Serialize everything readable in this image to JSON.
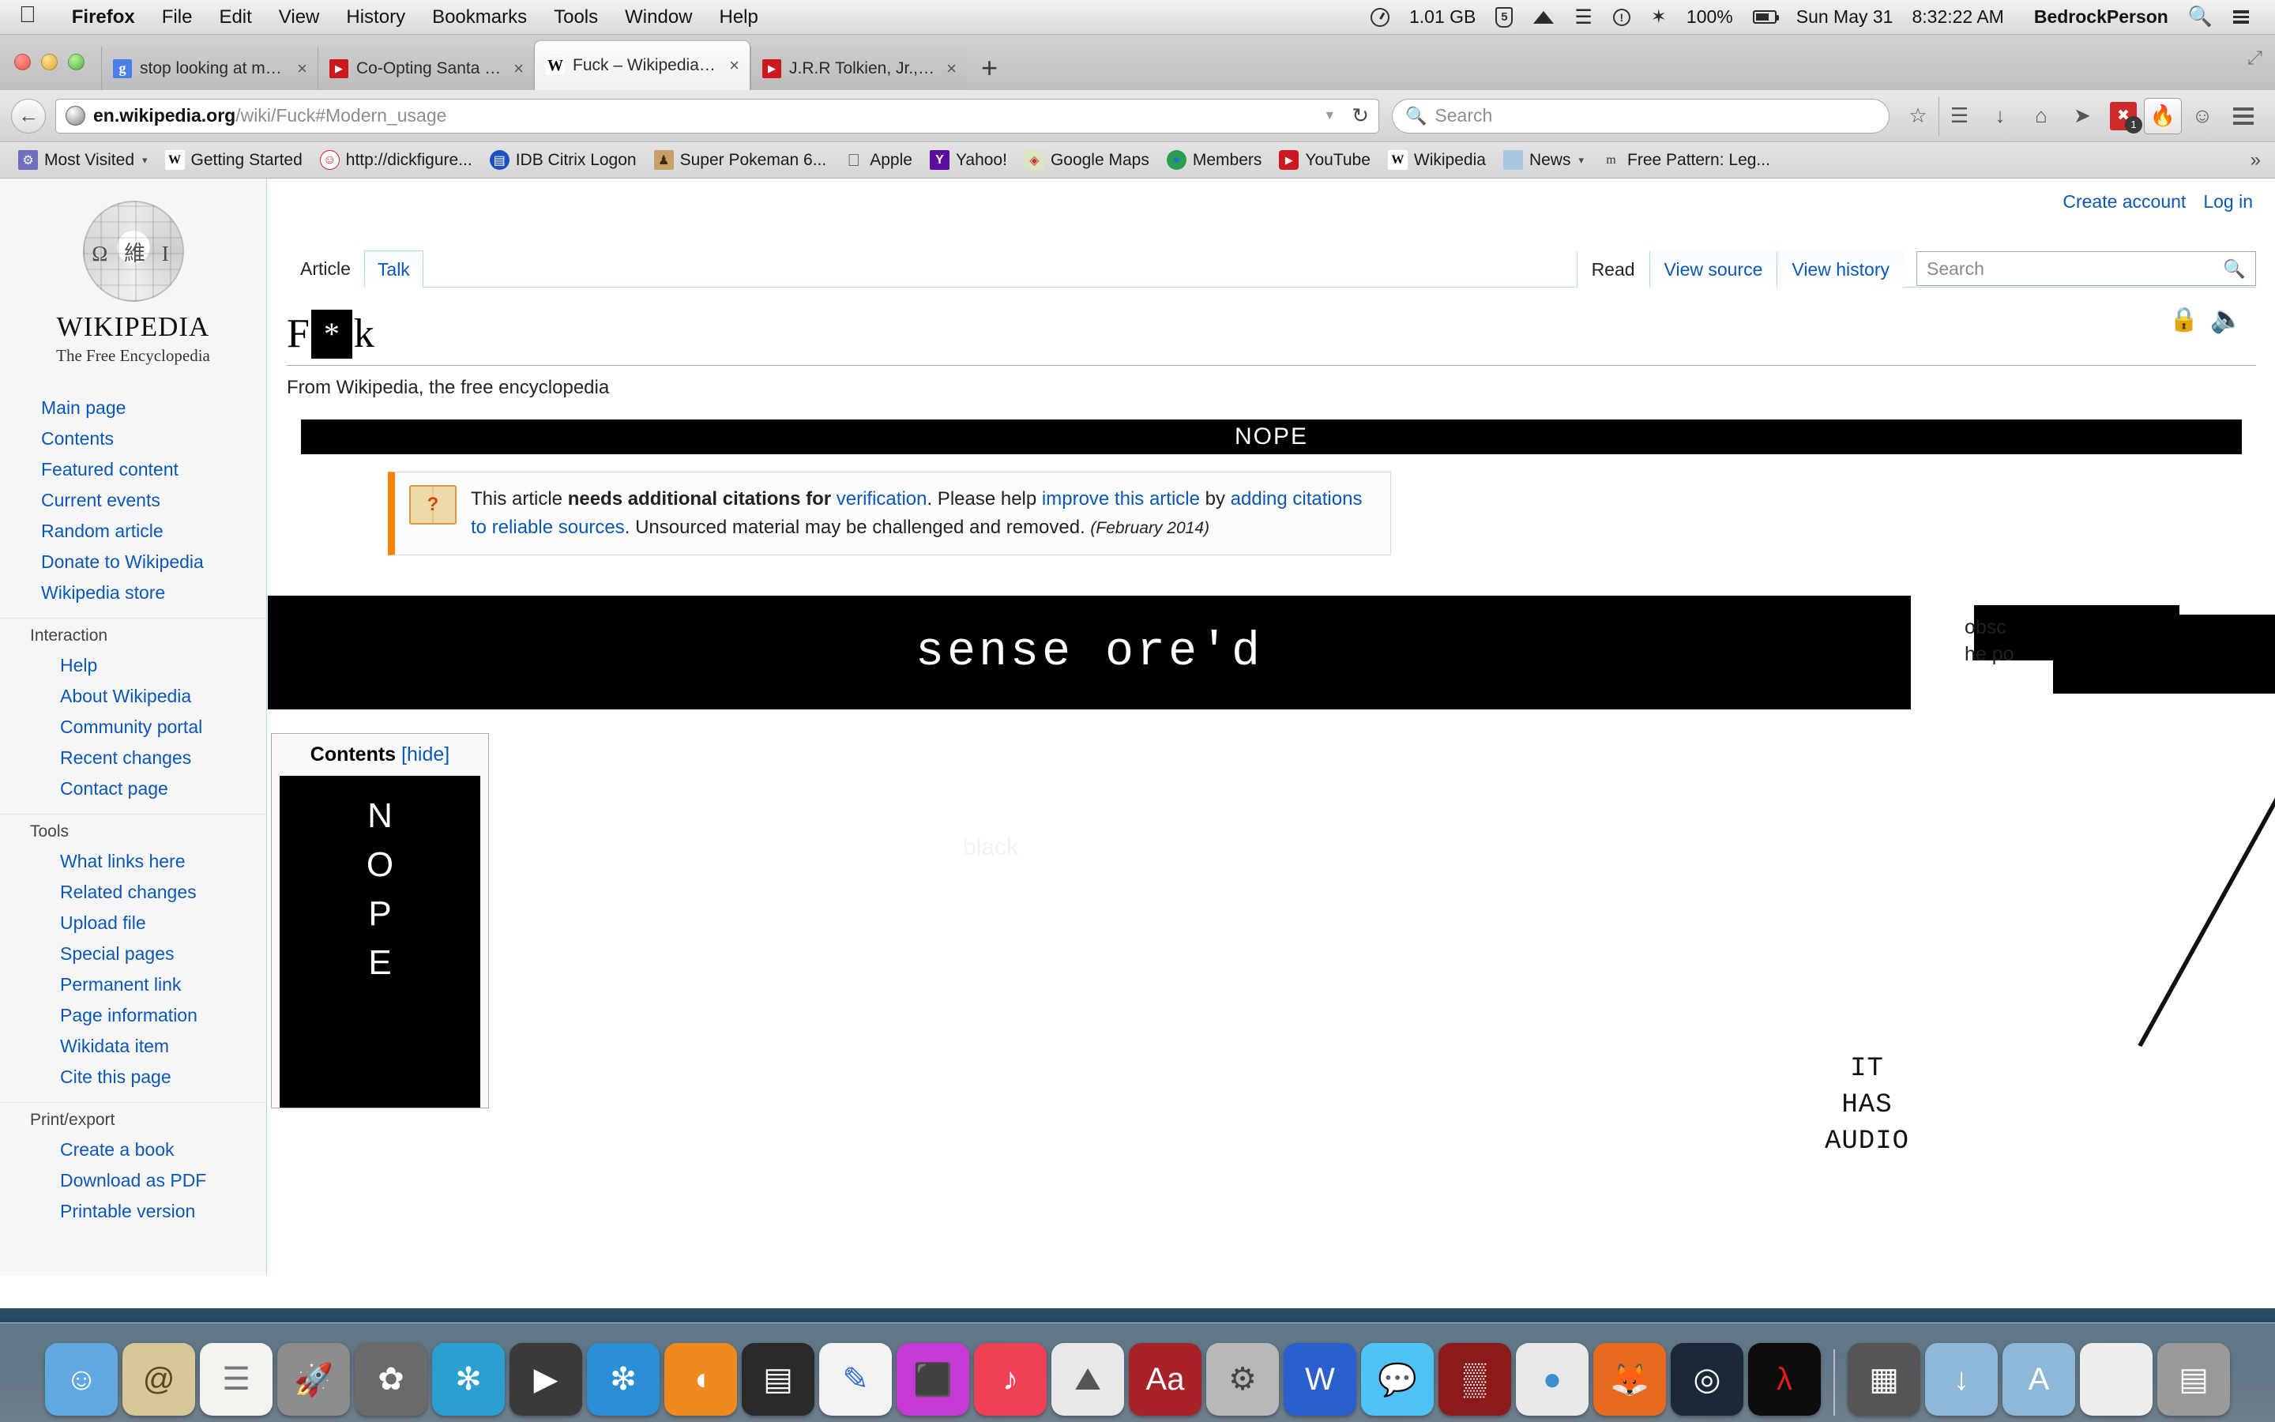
{
  "menubar": {
    "apple": "",
    "items": [
      {
        "label": "Firefox",
        "bold": true
      },
      {
        "label": "File"
      },
      {
        "label": "Edit"
      },
      {
        "label": "View"
      },
      {
        "label": "History"
      },
      {
        "label": "Bookmarks"
      },
      {
        "label": "Tools"
      },
      {
        "label": "Window"
      },
      {
        "label": "Help"
      }
    ],
    "status": {
      "memory": "1.01 GB",
      "badge": "5",
      "notify_glyph": "!",
      "bluetooth_glyph": "✶",
      "battery_percent": "100%",
      "date": "Sun May 31",
      "time": "8:32:22 AM",
      "user": "BedrockPerson",
      "search_icon": "search-icon",
      "list_icon": "notification-center-icon"
    }
  },
  "browser": {
    "tabs": [
      {
        "title": "stop looking at my tabs – ...",
        "favicon": "google-icon",
        "favicon_glyph": "g",
        "active": false
      },
      {
        "title": "Co-Opting Santa | Rob...",
        "favicon": "youtube-icon",
        "favicon_glyph": "▶",
        "active": false
      },
      {
        "title": "Fuck – Wikipedia, the free...",
        "favicon": "wikipedia-icon",
        "favicon_glyph": "W",
        "active": true
      },
      {
        "title": "J.R.R Tolkien, Jr., Jr. | Rob...",
        "favicon": "youtube-icon",
        "favicon_glyph": "▶",
        "active": false
      }
    ],
    "new_tab_label": "+",
    "close_glyph": "×",
    "nav": {
      "back_glyph": "←",
      "url_host": "en.wikipedia.org",
      "url_path": "/wiki/Fuck#Modern_usage",
      "dropdown_glyph": "▼",
      "reload_glyph": "↻",
      "search_placeholder": "Search",
      "search_icon": "search-icon",
      "icons": [
        {
          "name": "bookmark-star-icon",
          "glyph": "☆"
        },
        {
          "name": "reading-list-icon",
          "glyph": "☰"
        },
        {
          "name": "downloads-icon",
          "glyph": "↓"
        },
        {
          "name": "home-icon",
          "glyph": "⌂"
        },
        {
          "name": "send-tab-icon",
          "glyph": "➤"
        },
        {
          "name": "adblock-icon",
          "glyph": "✖",
          "badge": "1"
        },
        {
          "name": "fire-extension-icon",
          "glyph": "🔥"
        },
        {
          "name": "chat-extension-icon",
          "glyph": "☺"
        },
        {
          "name": "menu-hamburger-icon",
          "glyph": "☰"
        }
      ]
    },
    "bookmarks": [
      {
        "label": "Most Visited",
        "icon": "folder-icon",
        "glyph": "⚙",
        "caret": "▾",
        "color": "#6f6fbe"
      },
      {
        "label": "Getting Started",
        "icon": "wikipedia-icon",
        "glyph": "W",
        "color": "#ffffff",
        "text_color": "#000"
      },
      {
        "label": "http://dickfigure...",
        "icon": "dickfigures-icon",
        "glyph": "☺",
        "color": "#ffffff",
        "text_color": "#d22"
      },
      {
        "label": "IDB Citrix Logon",
        "icon": "citrix-icon",
        "glyph": "▤",
        "color": "#1f4fc4"
      },
      {
        "label": "Super Pokeman 6...",
        "icon": "sprite-icon",
        "glyph": "♟",
        "color": "#c9a06a"
      },
      {
        "label": "Apple",
        "icon": "apple-icon",
        "glyph": "",
        "color": "transparent",
        "text_color": "#555"
      },
      {
        "label": "Yahoo!",
        "icon": "yahoo-icon",
        "glyph": "Y",
        "color": "#5b0d9e"
      },
      {
        "label": "Google Maps",
        "icon": "maps-icon",
        "glyph": "◈",
        "color": "#d9e6c3",
        "text_color": "#c33"
      },
      {
        "label": "Members",
        "icon": "globe-icon",
        "glyph": "●",
        "color": "#2a9d4f"
      },
      {
        "label": "YouTube",
        "icon": "youtube-icon",
        "glyph": "▶",
        "color": "#cc181e"
      },
      {
        "label": "Wikipedia",
        "icon": "wikipedia-icon",
        "glyph": "W",
        "color": "#ffffff",
        "text_color": "#000"
      },
      {
        "label": "News",
        "icon": "folder-icon",
        "glyph": "",
        "caret": "▾",
        "color": "#a8c8e0"
      },
      {
        "label": "Free Pattern: Leg...",
        "icon": "ravelry-icon",
        "glyph": "m",
        "color": "transparent",
        "text_color": "#333"
      }
    ],
    "bookmarks_overflow_glyph": "»"
  },
  "wikipedia": {
    "wordmark": "WIKIPEDIA",
    "tagline": "The Free Encyclopedia",
    "logo_chars": "Ω 維 I",
    "user_nav": [
      "Create account",
      "Log in"
    ],
    "namespace_tabs": [
      {
        "label": "Article",
        "selected": true
      },
      {
        "label": "Talk",
        "selected": false
      }
    ],
    "view_tabs": [
      {
        "label": "Read",
        "selected": true
      },
      {
        "label": "View source",
        "selected": false
      },
      {
        "label": "View history",
        "selected": false
      }
    ],
    "search_placeholder": "Search",
    "search_icon": "search-icon",
    "sidebar": [
      {
        "type": "link",
        "label": "Main page"
      },
      {
        "type": "link",
        "label": "Contents"
      },
      {
        "type": "link",
        "label": "Featured content"
      },
      {
        "type": "link",
        "label": "Current events"
      },
      {
        "type": "link",
        "label": "Random article"
      },
      {
        "type": "link",
        "label": "Donate to Wikipedia"
      },
      {
        "type": "link",
        "label": "Wikipedia store"
      },
      {
        "type": "head",
        "label": "Interaction"
      },
      {
        "type": "sublink",
        "label": "Help"
      },
      {
        "type": "sublink",
        "label": "About Wikipedia"
      },
      {
        "type": "sublink",
        "label": "Community portal"
      },
      {
        "type": "sublink",
        "label": "Recent changes"
      },
      {
        "type": "sublink",
        "label": "Contact page"
      },
      {
        "type": "head",
        "label": "Tools"
      },
      {
        "type": "sublink",
        "label": "What links here"
      },
      {
        "type": "sublink",
        "label": "Related changes"
      },
      {
        "type": "sublink",
        "label": "Upload file"
      },
      {
        "type": "sublink",
        "label": "Special pages"
      },
      {
        "type": "sublink",
        "label": "Permanent link"
      },
      {
        "type": "sublink",
        "label": "Page information"
      },
      {
        "type": "sublink",
        "label": "Wikidata item"
      },
      {
        "type": "sublink",
        "label": "Cite this page"
      },
      {
        "type": "head",
        "label": "Print/export"
      },
      {
        "type": "sublink",
        "label": "Create a book"
      },
      {
        "type": "sublink",
        "label": "Download as PDF"
      },
      {
        "type": "sublink",
        "label": "Printable version"
      }
    ],
    "article": {
      "title_prefix": "F",
      "title_redacted": "*",
      "title_suffix": "k",
      "subtitle": "From Wikipedia, the free encyclopedia",
      "lock_icon": "semi-protected-lock-icon",
      "audio_icon": "spoken-article-audio-icon",
      "nope_banner": "NOPE",
      "citation_notice": {
        "text_1": "This article ",
        "bold_1": "needs additional citations for ",
        "link_1": "verification",
        "text_2": ". Please help ",
        "link_2": "improve this article",
        "text_3": " by ",
        "link_3": "adding citations to reliable sources",
        "text_4": ". Unsourced material may be challenged and removed.",
        "date": "(February 2014)",
        "icon": "open-book-question-icon"
      },
      "big_redaction_text": "sense ore'd",
      "leaked_fragment_1": "obsc",
      "leaked_fragment_2": "he po",
      "ghost_text": "black"
    },
    "toc": {
      "heading": "Contents",
      "toggle": "[hide]",
      "redacted_letters": [
        "N",
        "O",
        "P",
        "E"
      ]
    }
  },
  "annotation": {
    "lines": [
      "IT",
      "HAS",
      "AUDIO"
    ],
    "arrow_name": "hand-drawn-arrow"
  },
  "dock": {
    "items": [
      {
        "name": "finder",
        "glyph": "☺",
        "color": "#5fa8e0"
      },
      {
        "name": "mail",
        "glyph": "@",
        "color": "#d9c79a"
      },
      {
        "name": "reminders",
        "glyph": "☰",
        "color": "#f2f2ee"
      },
      {
        "name": "launchpad",
        "glyph": "🚀",
        "color": "#8c8c8c"
      },
      {
        "name": "iphoto",
        "glyph": "✿",
        "color": "#6a6a6a"
      },
      {
        "name": "photos",
        "glyph": "✻",
        "color": "#2b9fd0"
      },
      {
        "name": "quicktime",
        "glyph": "▶",
        "color": "#3a3a3a"
      },
      {
        "name": "safari",
        "glyph": "❇",
        "color": "#2b8ed6"
      },
      {
        "name": "ibooks",
        "glyph": "◖",
        "color": "#f08a1e"
      },
      {
        "name": "scanner",
        "glyph": "▤",
        "color": "#2a2a2a"
      },
      {
        "name": "pages",
        "glyph": "✎",
        "color": "#f2f2f2"
      },
      {
        "name": "imac-remote",
        "glyph": "⬛",
        "color": "#c83ad6"
      },
      {
        "name": "itunes",
        "glyph": "♪",
        "color": "#ef4056"
      },
      {
        "name": "preview",
        "glyph": "⛰",
        "color": "#e8e8e8"
      },
      {
        "name": "dictionary",
        "glyph": "Aa",
        "color": "#a8222a"
      },
      {
        "name": "system-preferences",
        "glyph": "⚙",
        "color": "#b8b8b8"
      },
      {
        "name": "word",
        "glyph": "W",
        "color": "#2b5fd0"
      },
      {
        "name": "messages",
        "glyph": "💬",
        "color": "#4fc3f7"
      },
      {
        "name": "photo-booth",
        "glyph": "▒",
        "color": "#8b1a1a"
      },
      {
        "name": "chrome",
        "glyph": "●",
        "color": "#e8e8e8"
      },
      {
        "name": "firefox",
        "glyph": "🦊",
        "color": "#e86a1e"
      },
      {
        "name": "steam",
        "glyph": "◎",
        "color": "#1b2838"
      },
      {
        "name": "half-life",
        "glyph": "λ",
        "color": "#0d0d0d"
      }
    ],
    "folders": [
      {
        "name": "downloads-stack",
        "glyph": "▦",
        "color": "#555"
      },
      {
        "name": "documents-folder",
        "glyph": "↓",
        "color": "#8fb8d8"
      },
      {
        "name": "applications-folder",
        "glyph": "A",
        "color": "#8fb8d8"
      },
      {
        "name": "white-stack",
        "glyph": "",
        "color": "#ededed"
      },
      {
        "name": "trash",
        "glyph": "▤",
        "color": "#9a9a9a"
      }
    ]
  }
}
